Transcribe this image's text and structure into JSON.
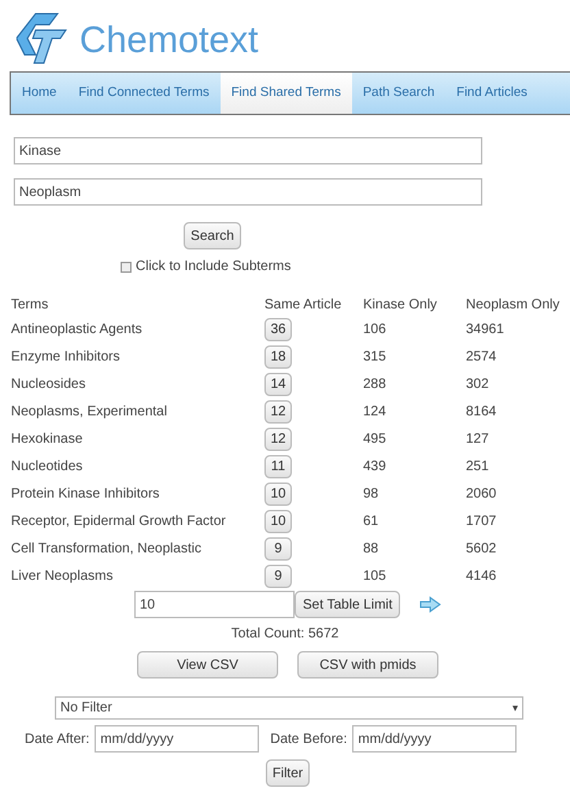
{
  "logo": {
    "text": "Chemotext"
  },
  "nav": [
    {
      "label": "Home",
      "selected": false
    },
    {
      "label": "Find Connected Terms",
      "selected": false
    },
    {
      "label": "Find Shared Terms",
      "selected": true
    },
    {
      "label": "Path Search",
      "selected": false
    },
    {
      "label": "Find Articles",
      "selected": false
    }
  ],
  "search_fields": [
    {
      "value": "Kinase"
    },
    {
      "value": "Neoplasm"
    }
  ],
  "search_button": "Search",
  "subterms": {
    "label": "Click to Include Subterms",
    "checked": false
  },
  "table": {
    "columns": [
      "Terms",
      "Same Article",
      "Kinase Only",
      "Neoplasm Only"
    ],
    "rows": [
      {
        "term": "Antineoplastic Agents",
        "same": "36",
        "a_only": "106",
        "b_only": "34961"
      },
      {
        "term": "Enzyme Inhibitors",
        "same": "18",
        "a_only": "315",
        "b_only": "2574"
      },
      {
        "term": "Nucleosides",
        "same": "14",
        "a_only": "288",
        "b_only": "302"
      },
      {
        "term": "Neoplasms, Experimental",
        "same": "12",
        "a_only": "124",
        "b_only": "8164"
      },
      {
        "term": "Hexokinase",
        "same": "12",
        "a_only": "495",
        "b_only": "127"
      },
      {
        "term": "Nucleotides",
        "same": "11",
        "a_only": "439",
        "b_only": "251"
      },
      {
        "term": "Protein Kinase Inhibitors",
        "same": "10",
        "a_only": "98",
        "b_only": "2060"
      },
      {
        "term": "Receptor, Epidermal Growth Factor",
        "same": "10",
        "a_only": "61",
        "b_only": "1707"
      },
      {
        "term": "Cell Transformation, Neoplastic",
        "same": "9",
        "a_only": "88",
        "b_only": "5602"
      },
      {
        "term": "Liver Neoplasms",
        "same": "9",
        "a_only": "105",
        "b_only": "4146"
      }
    ]
  },
  "limit": {
    "value": "10",
    "button": "Set Table Limit"
  },
  "total": "Total Count: 5672",
  "csv_buttons": [
    "View CSV",
    "CSV with pmids"
  ],
  "filter_select": {
    "value": "No Filter",
    "arrow": "▾"
  },
  "dates": [
    {
      "label": "Date After:",
      "placeholder": "mm/dd/yyyy"
    },
    {
      "label": "Date Before:",
      "placeholder": "mm/dd/yyyy"
    }
  ],
  "filter_button": "Filter"
}
